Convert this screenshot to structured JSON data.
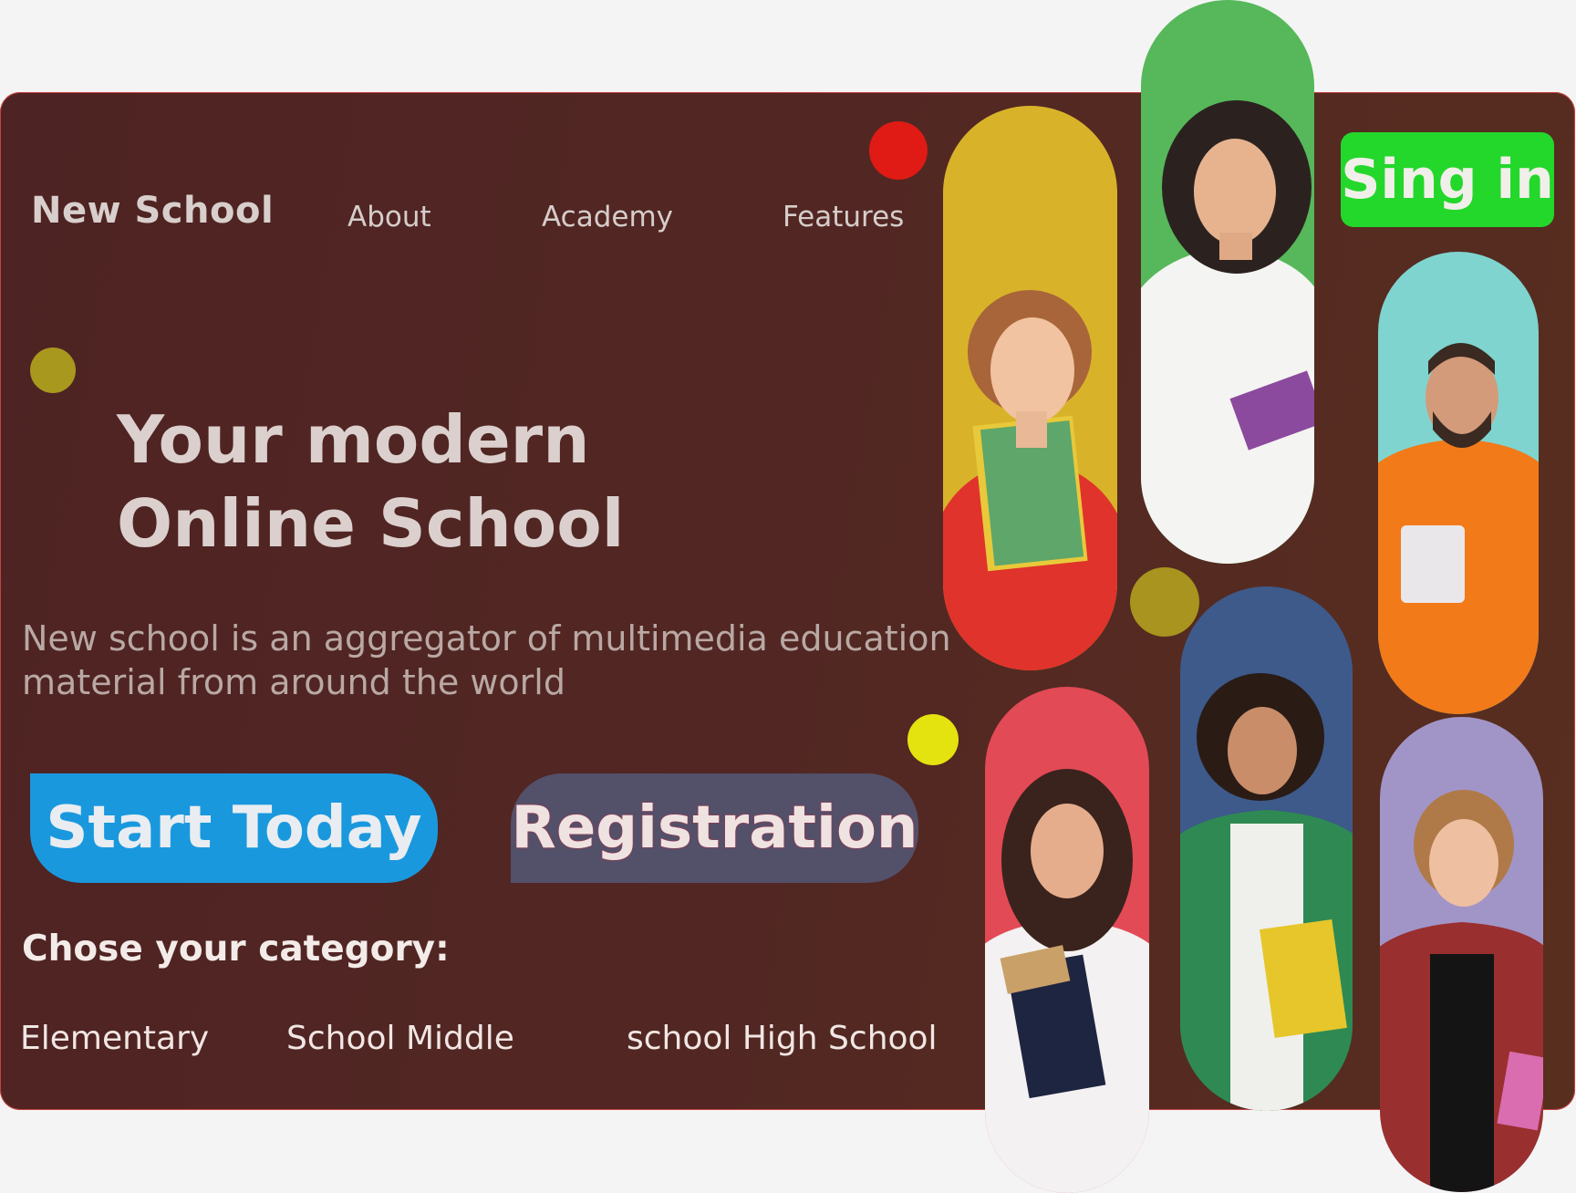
{
  "header": {
    "brand": "New School",
    "nav": [
      "About",
      "Academy",
      "Features"
    ],
    "signin_label": "Sing in"
  },
  "hero": {
    "title_line1": "Your modern",
    "title_line2": "Online School",
    "description": "New school is an aggregator of multimedia education material from around the world"
  },
  "buttons": {
    "start": "Start Today",
    "registration": "Registration"
  },
  "categories": {
    "title": "Chose your category:",
    "items": [
      "Elementary",
      "School Middle",
      "school High School"
    ]
  },
  "colors": {
    "card_bg": "#522723",
    "start_button": "#1a98de",
    "registration_button": "#53506a",
    "signin_button": "#23d72b",
    "accent_red": "#e01a14",
    "accent_olive": "#a8981e",
    "accent_yellow": "#e4e20f"
  },
  "photos": [
    {
      "name": "student-yellow",
      "bg": "#d8b329"
    },
    {
      "name": "student-green",
      "bg": "#56b85a"
    },
    {
      "name": "student-cyan",
      "bg": "#7fd4cf"
    },
    {
      "name": "student-red",
      "bg": "#e24a55"
    },
    {
      "name": "student-blue",
      "bg": "#3d5a8a"
    },
    {
      "name": "student-lavender",
      "bg": "#a195c8"
    }
  ]
}
